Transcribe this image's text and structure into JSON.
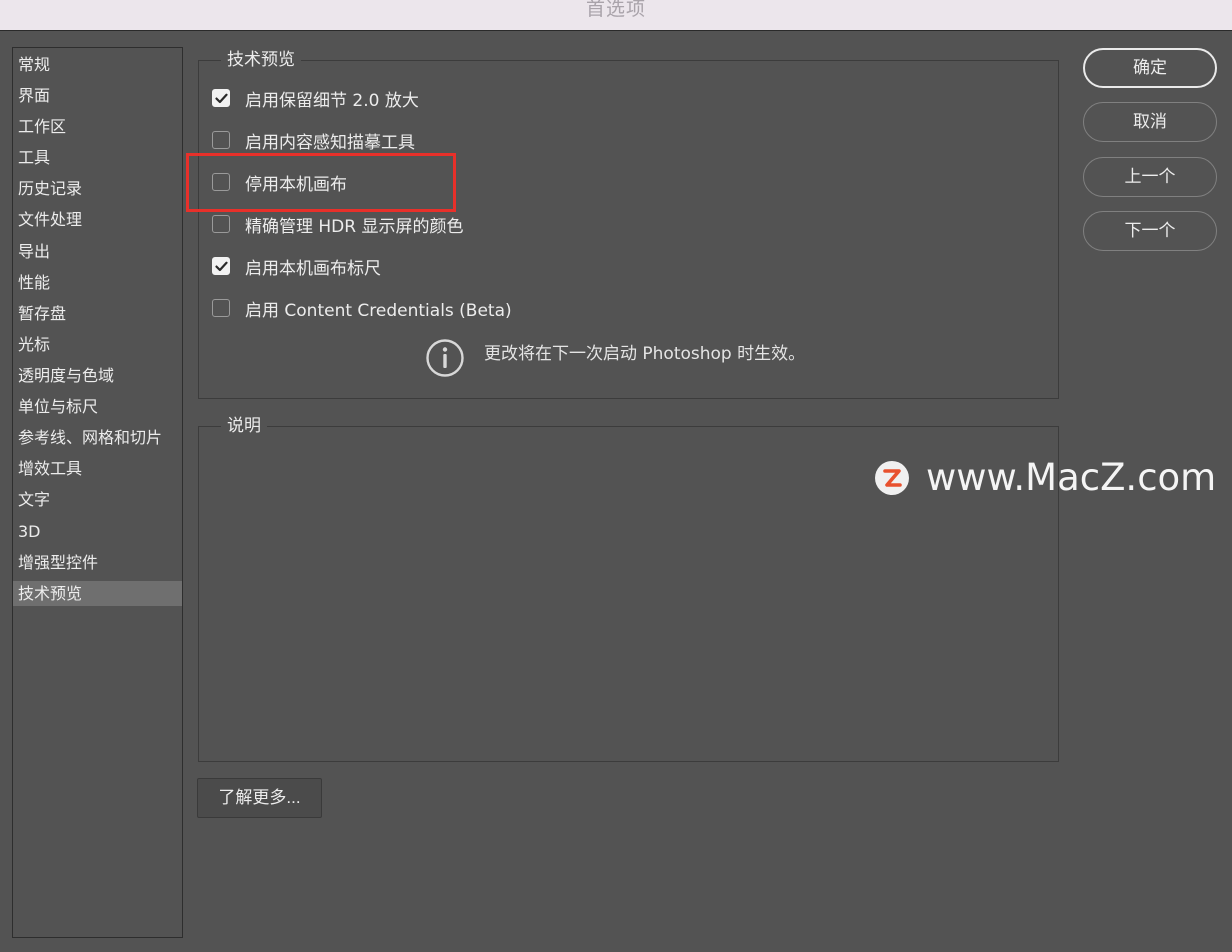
{
  "window": {
    "title": "首选项"
  },
  "sidebar": {
    "items": [
      {
        "label": "常规"
      },
      {
        "label": "界面"
      },
      {
        "label": "工作区"
      },
      {
        "label": "工具"
      },
      {
        "label": "历史记录"
      },
      {
        "label": "文件处理"
      },
      {
        "label": "导出"
      },
      {
        "label": "性能"
      },
      {
        "label": "暂存盘"
      },
      {
        "label": "光标"
      },
      {
        "label": "透明度与色域"
      },
      {
        "label": "单位与标尺"
      },
      {
        "label": "参考线、网格和切片"
      },
      {
        "label": "增效工具"
      },
      {
        "label": "文字"
      },
      {
        "label": "3D"
      },
      {
        "label": "增强型控件"
      },
      {
        "label": "技术预览"
      }
    ],
    "selected": "技术预览"
  },
  "tech_preview": {
    "title": "技术预览",
    "options": [
      {
        "label": "启用保留细节 2.0 放大",
        "checked": true
      },
      {
        "label": "启用内容感知描摹工具",
        "checked": false
      },
      {
        "label": "停用本机画布",
        "checked": false
      },
      {
        "label": "精确管理 HDR 显示屏的颜色",
        "checked": false
      },
      {
        "label": "启用本机画布标尺",
        "checked": true
      },
      {
        "label": "启用 Content Credentials (Beta)",
        "checked": false
      }
    ],
    "notice": "更改将在下一次启动 Photoshop 时生效。"
  },
  "description": {
    "title": "说明"
  },
  "learn_more_label": "了解更多...",
  "buttons": {
    "ok": "确定",
    "cancel": "取消",
    "prev": "上一个",
    "next": "下一个"
  },
  "watermark": {
    "text": "www.MacZ.com",
    "logo_letter": "Z"
  },
  "colors": {
    "panel_bg": "#535353",
    "highlight": "#e8302a",
    "selected_item": "#6f6f6f",
    "watermark_logo": "#e8512e"
  }
}
